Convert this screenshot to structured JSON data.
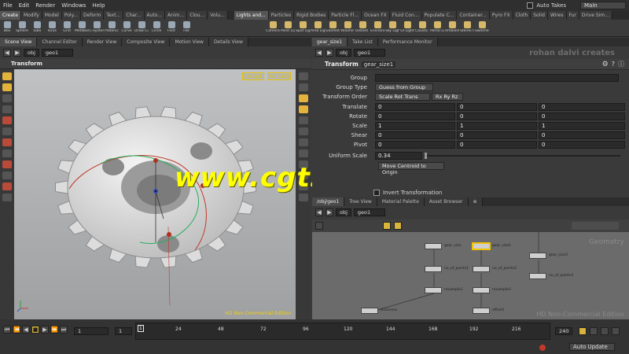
{
  "menu": [
    "File",
    "Edit",
    "Render",
    "Windows",
    "Help"
  ],
  "menu_right": {
    "auto_takes": "Auto Takes",
    "desktop": "Main"
  },
  "shelf_tabs_left": [
    "Create",
    "Modify",
    "Model",
    "Poly...",
    "Deform",
    "Text...",
    "Char...",
    "Auto...",
    "Anim...",
    "Clou...",
    "Volu..."
  ],
  "shelf_tabs_right": [
    "Lights and...",
    "Particles",
    "Rigid Bodies",
    "Particle Fl...",
    "Ocean FX",
    "Fluid Con...",
    "Populate C...",
    "Container...",
    "Pyro FX",
    "Cloth",
    "Solid",
    "Wires",
    "Fur",
    "Drive Sim..."
  ],
  "tools_left": [
    "Box",
    "Sphere",
    "Tube",
    "Torus",
    "Grid",
    "Metaball",
    "L-System",
    "Platonic So...",
    "Curve",
    "Draw Curve",
    "Circle",
    "Font",
    "File"
  ],
  "tools_right": [
    "Camera",
    "Point Light",
    "Spot Light",
    "Area Light",
    "Geometry...",
    "Volume Li...",
    "Distant Light",
    "Environme...",
    "Sky Light",
    "GI Light",
    "Caustic Li...",
    "Portal Light",
    "Ambient Li...",
    "Stereo Ca...",
    "Switcher"
  ],
  "panel_tabs_left": [
    "Scene View",
    "Channel Editor",
    "Render View",
    "Composite View",
    "Motion View",
    "Details View"
  ],
  "panel_tabs_right": [
    "gear_size1",
    "Take List",
    "Performance Monitor"
  ],
  "viewport": {
    "path": "obj",
    "node": "geo1",
    "title": "Transform",
    "cam": "persp1",
    "camdrop": "no cam",
    "edition": "HD Non-Commercial Edition",
    "watermark": "www.cgtsj.com"
  },
  "params": {
    "path": "obj",
    "node": "geo1",
    "header": "Transform",
    "name": "gear_size1",
    "overlay_brand": "rohan dalvi creates",
    "group_label": "Group",
    "group_type_label": "Group Type",
    "group_type_value": "Guess from Group",
    "transform_order_label": "Transform Order",
    "transform_order_value": "Scale Rot Trans",
    "rot_order_value": "Rx Ry Rz",
    "rows": [
      {
        "label": "Translate",
        "values": [
          "0",
          "0",
          "0"
        ]
      },
      {
        "label": "Rotate",
        "values": [
          "0",
          "0",
          "0"
        ]
      },
      {
        "label": "Scale",
        "values": [
          "1",
          "1",
          "1"
        ]
      },
      {
        "label": "Shear",
        "values": [
          "0",
          "0",
          "0"
        ]
      },
      {
        "label": "Pivot",
        "values": [
          "0",
          "0",
          "0"
        ]
      }
    ],
    "uniform_scale_label": "Uniform Scale",
    "uniform_scale_value": "0.34",
    "move_centroid": "Move Centroid to Origin",
    "invert": "Invert Transformation"
  },
  "network": {
    "tabs": [
      "/obj/geo1",
      "Tree View",
      "Material Palette",
      "Asset Browser"
    ],
    "path": "obj",
    "node": "geo1",
    "context": "Geometry",
    "edition": "HD Non-Commercial Edition",
    "nodes": [
      "gear_size",
      "gear_size1",
      "gear_size3",
      "no_of_points1",
      "no_of_points2",
      "no_of_points3",
      "resample1",
      "resample3",
      "offset1",
      "thickness"
    ]
  },
  "timeline": {
    "ticks": [
      "1",
      "24",
      "48",
      "72",
      "96",
      "120",
      "144",
      "168",
      "192",
      "216"
    ],
    "start": "1",
    "start2": "1",
    "end": "240",
    "mode": "Auto Update"
  }
}
